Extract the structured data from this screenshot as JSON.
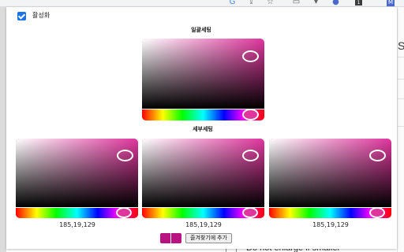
{
  "popup": {
    "enable_label": "활성화",
    "enabled": true,
    "global_section_title": "일괄세팅",
    "detail_section_title": "세부세팅",
    "hue_color": "#e0359d",
    "hue_handle_color": "#e0359d",
    "detail_pickers": [
      {
        "rgb_text": "185,19,129"
      },
      {
        "rgb_text": "185,19,129"
      },
      {
        "rgb_text": "185,19,129"
      }
    ],
    "footer": {
      "swatch_color_1": "#b91381",
      "swatch_color_2": "#b91381",
      "add_favorite_label": "즐겨찾기에 추가"
    }
  },
  "background": {
    "right_edge_letter": "S",
    "bottom_checkbox_label": "Do not enlarge if smaller",
    "toolbar_icons": [
      "google-icon",
      "share-icon",
      "star-icon",
      "extension-icon",
      "download-icon",
      "profile-icon"
    ]
  }
}
